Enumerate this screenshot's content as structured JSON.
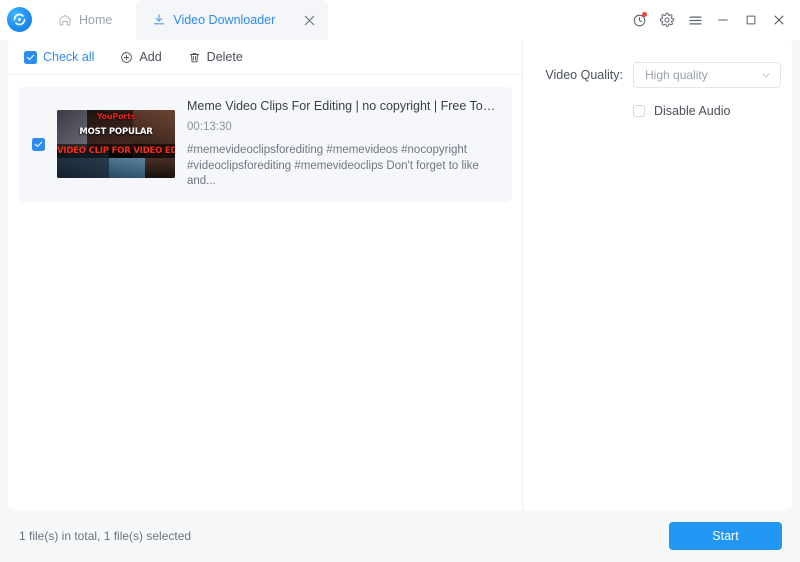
{
  "window": {
    "logo_icon": "app-logo-refresh-icon",
    "controls": [
      {
        "name": "history-icon",
        "glyph": "history",
        "badge": true
      },
      {
        "name": "settings-gear-icon",
        "glyph": "gear",
        "badge": false
      },
      {
        "name": "menu-icon",
        "glyph": "hamburger",
        "badge": false
      },
      {
        "name": "minimize-icon",
        "glyph": "minimize",
        "badge": false
      },
      {
        "name": "maximize-icon",
        "glyph": "maximize",
        "badge": false
      },
      {
        "name": "close-icon",
        "glyph": "close",
        "badge": false
      }
    ]
  },
  "tabs": {
    "home": {
      "label": "Home",
      "icon": "home-icon"
    },
    "active": {
      "label": "Video Downloader",
      "icon": "download-icon",
      "close": "✕"
    }
  },
  "toolbar": {
    "check_all": "Check all",
    "add": "Add",
    "delete": "Delete",
    "add_icon": "plus-circle-icon",
    "delete_icon": "trash-icon"
  },
  "list": {
    "items": [
      {
        "checked": true,
        "title": "Meme Video Clips For Editing | no copyright | Free To Used",
        "duration": "00:13:30",
        "description": "#memevideoclipsforediting #memevideos #nocopyright #videoclipsforediting #memevideoclips Don't forget to like and...",
        "thumbnail": {
          "top_text": "YouPorts",
          "mid_text": "MOST POPULAR",
          "band_text": "VIDEO CLIP FOR VIDEO EDITING"
        }
      }
    ]
  },
  "options": {
    "quality_label": "Video Quality:",
    "quality_value": "High quality",
    "disable_audio_label": "Disable Audio",
    "disable_audio_checked": false
  },
  "footer": {
    "status": "1 file(s) in total, 1 file(s) selected",
    "start": "Start"
  },
  "colors": {
    "accent": "#2d8cf0",
    "start_button": "#2196f3",
    "badge": "#f0453a",
    "row_bg": "#f5f7fb",
    "app_bg": "#f6f8fa"
  }
}
